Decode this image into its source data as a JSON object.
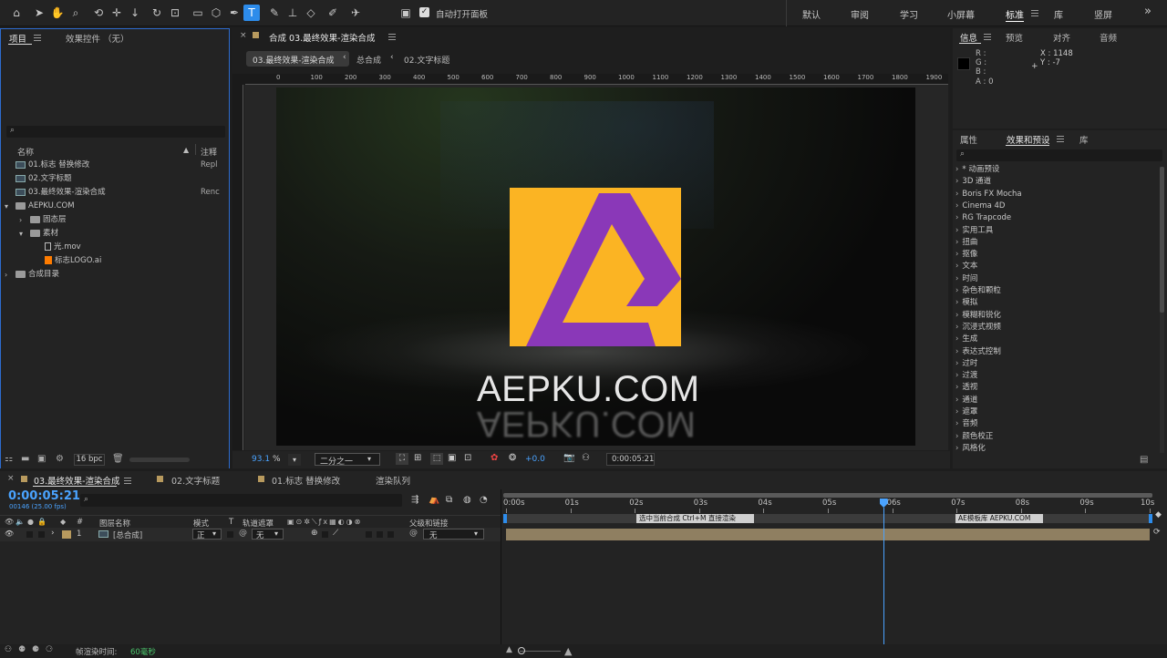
{
  "toolbar": {
    "auto_open_panel_label": "自动打开面板",
    "workspaces": [
      "默认",
      "审阅",
      "学习",
      "小屏幕",
      "标准",
      "库",
      "竖屏"
    ],
    "active_workspace": "标准",
    "more_glyph": "»"
  },
  "project_panel": {
    "tabs": [
      "项目",
      "效果控件 （无）"
    ],
    "columns": {
      "name": "名称",
      "comment": "注释"
    },
    "items": [
      {
        "label": "01.标志 替换修改",
        "comment": "Repl",
        "type": "comp",
        "indent": 0
      },
      {
        "label": "02.文字标题",
        "comment": "",
        "type": "comp",
        "indent": 0
      },
      {
        "label": "03.最终效果-渲染合成",
        "comment": "Renc",
        "type": "comp",
        "indent": 0
      },
      {
        "label": "AEPKU.COM",
        "comment": "",
        "type": "folder",
        "indent": 0
      },
      {
        "label": "固态层",
        "comment": "",
        "type": "folder",
        "indent": 1
      },
      {
        "label": "素材",
        "comment": "",
        "type": "folder",
        "indent": 1
      },
      {
        "label": "光.mov",
        "comment": "",
        "type": "file",
        "indent": 2
      },
      {
        "label": "标志LOGO.ai",
        "comment": "",
        "type": "ai",
        "indent": 2
      },
      {
        "label": "合成目录",
        "comment": "",
        "type": "folder",
        "indent": 0
      }
    ],
    "bpc": "16 bpc"
  },
  "composition": {
    "tab_title": "合成 03.最终效果-渲染合成",
    "breadcrumbs": [
      "03.最终效果-渲染合成",
      "总合成",
      "02.文字标题"
    ],
    "ruler": [
      "0",
      "100",
      "200",
      "300",
      "400",
      "500",
      "600",
      "700",
      "800",
      "900",
      "1000",
      "1100",
      "1200",
      "1300",
      "1400",
      "1500",
      "1600",
      "1700",
      "1800",
      "1900"
    ],
    "logo_text": "AEPKU.COM",
    "zoom": "93.1",
    "zoom_unit": "%",
    "resolution": "二分之一",
    "exposure": "+0.0",
    "timecode": "0:00:05:21",
    "colors": {
      "logo_bg": "#fbb423",
      "logo_mark": "#8a38b8"
    }
  },
  "info_panel": {
    "tabs": [
      "信息",
      "预览",
      "对齐",
      "音频"
    ],
    "r": "R :",
    "g": "G :",
    "b": "B :",
    "a": "A : 0",
    "x": "X : 1148",
    "y": "Y : -7"
  },
  "effects_panel": {
    "tabs": [
      "属性",
      "效果和预设",
      "库"
    ],
    "items": [
      "* 动画预设",
      "3D 通道",
      "Boris FX Mocha",
      "Cinema 4D",
      "RG Trapcode",
      "实用工具",
      "扭曲",
      "抠像",
      "文本",
      "时间",
      "杂色和颗粒",
      "模拟",
      "模糊和锐化",
      "沉浸式视频",
      "生成",
      "表达式控制",
      "过时",
      "过渡",
      "透视",
      "通道",
      "遮罩",
      "音频",
      "颜色校正",
      "风格化"
    ]
  },
  "timeline": {
    "tabs": [
      "03.最终效果-渲染合成",
      "02.文字标题",
      "01.标志 替换修改",
      "渲染队列"
    ],
    "timecode": "0:00:05:21",
    "frame_info": "00146 (25.00 fps)",
    "columns": {
      "num": "#",
      "layer_name": "图层名称",
      "mode": "模式",
      "t": "T",
      "track_matte": "轨道遮罩",
      "parent": "父级和链接"
    },
    "layer": {
      "number": "1",
      "name": "[总合成]",
      "mode": "正",
      "matte": "无",
      "parent": "无"
    },
    "time_marks": [
      "0:00s",
      "01s",
      "02s",
      "03s",
      "04s",
      "05s",
      "06s",
      "07s",
      "08s",
      "09s",
      "10s"
    ],
    "markers": [
      "选中当前合成  Ctrl+M  直接渲染",
      "AE模板库  AEPKU.COM"
    ],
    "playhead_fraction": 0.586,
    "frame_render_label": "帧渲染时间:",
    "frame_render_value": "60毫秒"
  }
}
